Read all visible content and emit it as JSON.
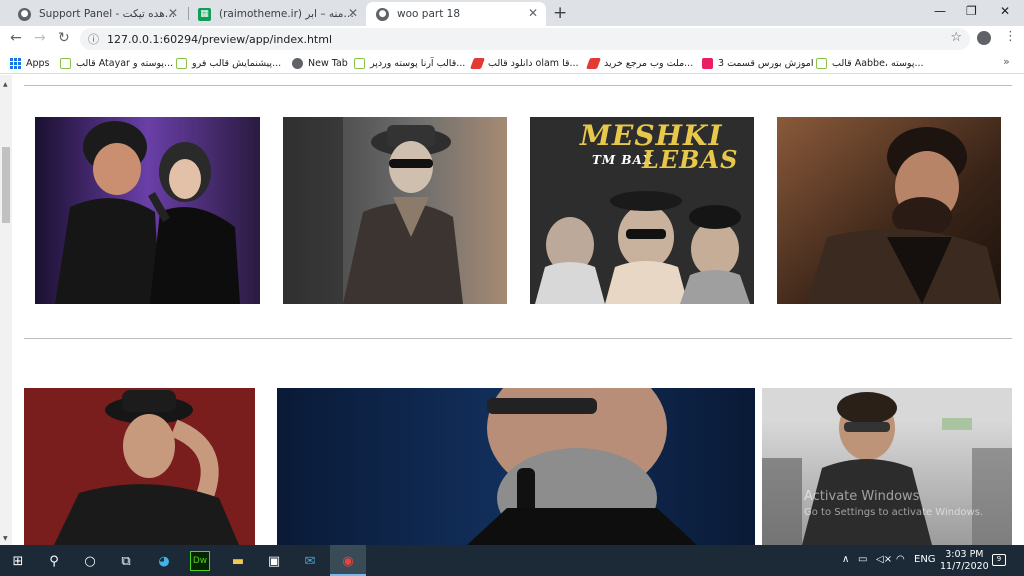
{
  "browser": {
    "tabs": [
      {
        "title": "Support Panel - مشاهده تیکت",
        "active": false
      },
      {
        "title": "(raimotheme.ir) نمایش دامنه – ابر...",
        "active": false
      },
      {
        "title": "woo part 18",
        "active": true
      }
    ],
    "address": "127.0.0.1:60294/preview/app/index.html",
    "bookmarks": [
      {
        "label": "Apps",
        "icon": "apps-grid-icon"
      },
      {
        "label": "قالب Atayar پوسته و...",
        "icon": "n-logo-icon"
      },
      {
        "label": "پیشنمایش قالب فرو...",
        "icon": "n-logo-icon"
      },
      {
        "label": "New Tab",
        "icon": "globe-icon"
      },
      {
        "label": "قالب آرنا پوسته وردپر...",
        "icon": "n-logo-icon"
      },
      {
        "label": "دانلود قالب olam قا...",
        "icon": "red-arrow-icon"
      },
      {
        "label": "ملت وب مرجع خرید...",
        "icon": "red-arrow-icon"
      },
      {
        "label": "اموزش بورس قسمت 3",
        "icon": "pink-grid-icon"
      },
      {
        "label": "قالب Aabbe، پوسته...",
        "icon": "n-logo-icon"
      }
    ]
  },
  "page": {
    "poster": {
      "line1": "MESHKI",
      "line2": "TM BAX",
      "line3": "LEBAS"
    }
  },
  "os": {
    "watermark_title": "Activate Windows",
    "watermark_sub": "Go to Settings to activate Windows.",
    "lang": "ENG",
    "time": "3:03 PM",
    "date": "11/7/2020",
    "notifications": "9"
  },
  "colors": {
    "tab_bg": "#dee1e6",
    "taskbar": "#1b2a36",
    "accent": "#1a73e8"
  }
}
